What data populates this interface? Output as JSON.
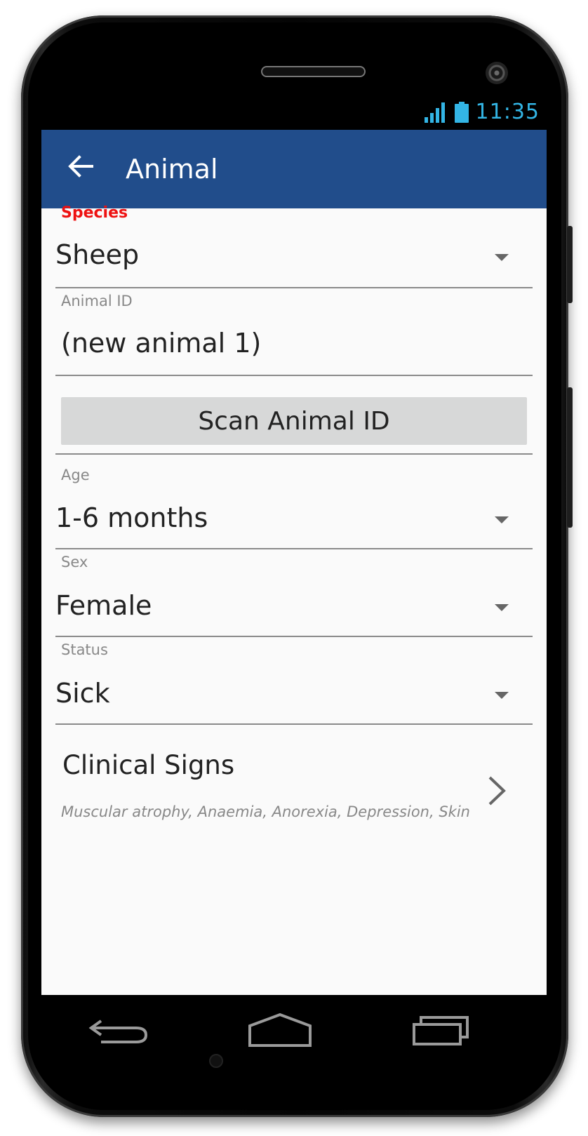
{
  "status_bar": {
    "time": "11:35",
    "accent_color": "#33b5e5",
    "icons": [
      "signal-icon",
      "battery-icon"
    ]
  },
  "app_bar": {
    "title": "Animal",
    "color": "#214d8b",
    "back_icon": "arrow-back-icon"
  },
  "form": {
    "species": {
      "label": "Species",
      "value": "Sheep",
      "label_color": "#ee1111"
    },
    "animal_id": {
      "label": "Animal ID",
      "value": "(new animal 1)"
    },
    "scan_button": "Scan Animal ID",
    "age": {
      "label": "Age",
      "value": "1-6 months"
    },
    "sex": {
      "label": "Sex",
      "value": "Female"
    },
    "status": {
      "label": "Status",
      "value": "Sick"
    },
    "clinical_signs": {
      "title": "Clinical Signs",
      "summary": "Muscular atrophy, Anaemia, Anorexia, Depression, Skin - lesions"
    }
  },
  "nav_bar": {
    "icons": [
      "nav-back-icon",
      "nav-home-icon",
      "nav-recents-icon"
    ]
  }
}
